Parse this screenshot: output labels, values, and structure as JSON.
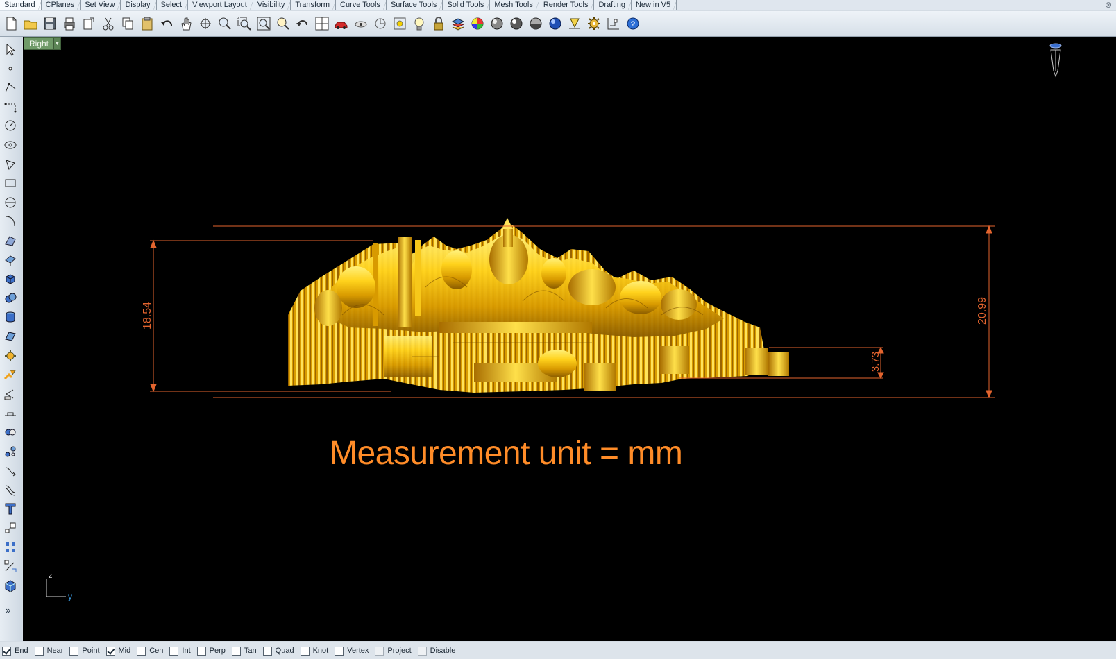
{
  "tabs": [
    "Standard",
    "CPlanes",
    "Set View",
    "Display",
    "Select",
    "Viewport Layout",
    "Visibility",
    "Transform",
    "Curve Tools",
    "Surface Tools",
    "Solid Tools",
    "Mesh Tools",
    "Render Tools",
    "Drafting",
    "New in V5"
  ],
  "active_tab": "Standard",
  "toolbar_icons": [
    "new-icon",
    "open-icon",
    "save-icon",
    "print-icon",
    "import-icon",
    "cut-icon",
    "copy-icon",
    "paste-icon",
    "undo-icon",
    "pan-hand-icon",
    "rotate-view-icon",
    "zoom-icon",
    "zoom-window-icon",
    "zoom-extents-icon",
    "zoom-selected-icon",
    "undo-view-icon",
    "four-viewports-icon",
    "car-icon",
    "hide-icon",
    "show-icon",
    "lights-icon",
    "light-bulb-icon",
    "lock-icon",
    "layer-icon",
    "color-wheel-icon",
    "shaded-sphere-icon",
    "rendered-sphere-icon",
    "glossy-sphere-icon",
    "blue-sphere-icon",
    "dimension-icon",
    "settings-gear-icon",
    "grid-snap-icon",
    "help-icon"
  ],
  "left_icons": [
    "select-arrow-icon",
    "point-icon",
    "polyline-icon",
    "curve-icon",
    "circle-icon",
    "ellipse-icon",
    "polygon-icon",
    "rectangle-icon",
    "arc-icon",
    "fillet-curve-icon",
    "surface-corner-icon",
    "extrude-icon",
    "box-icon",
    "sphere-icon",
    "cylinder-icon",
    "plane-icon",
    "gear-solid-icon",
    "boolean-icon",
    "split-icon",
    "trim-icon",
    "join-icon",
    "explode-icon",
    "blend-icon",
    "offset-icon",
    "text-icon",
    "scale-icon",
    "array-icon",
    "edit-points-icon",
    "solid-box-icon"
  ],
  "left_more": "»",
  "viewport": {
    "name": "Right",
    "dropdown_glyph": "▼",
    "unit_note": "Measurement unit = mm",
    "dims": {
      "left": "18.54",
      "right": "20.99",
      "small": "3.73"
    },
    "axis_z": "z",
    "axis_y": "y"
  },
  "osnaps": [
    {
      "label": "End",
      "checked": true,
      "disabled": false
    },
    {
      "label": "Near",
      "checked": false,
      "disabled": false
    },
    {
      "label": "Point",
      "checked": false,
      "disabled": false
    },
    {
      "label": "Mid",
      "checked": true,
      "disabled": false
    },
    {
      "label": "Cen",
      "checked": false,
      "disabled": false
    },
    {
      "label": "Int",
      "checked": false,
      "disabled": false
    },
    {
      "label": "Perp",
      "checked": false,
      "disabled": false
    },
    {
      "label": "Tan",
      "checked": false,
      "disabled": false
    },
    {
      "label": "Quad",
      "checked": false,
      "disabled": false
    },
    {
      "label": "Knot",
      "checked": false,
      "disabled": false
    },
    {
      "label": "Vertex",
      "checked": false,
      "disabled": false
    },
    {
      "label": "Project",
      "checked": false,
      "disabled": true
    },
    {
      "label": "Disable",
      "checked": false,
      "disabled": true
    }
  ],
  "colors": {
    "viewport_bg": "#000000",
    "dimension": "#e3642e",
    "model_gold": "#e0a800",
    "unit_text": "#ff8c28",
    "viewport_label": "#6f9a68"
  }
}
